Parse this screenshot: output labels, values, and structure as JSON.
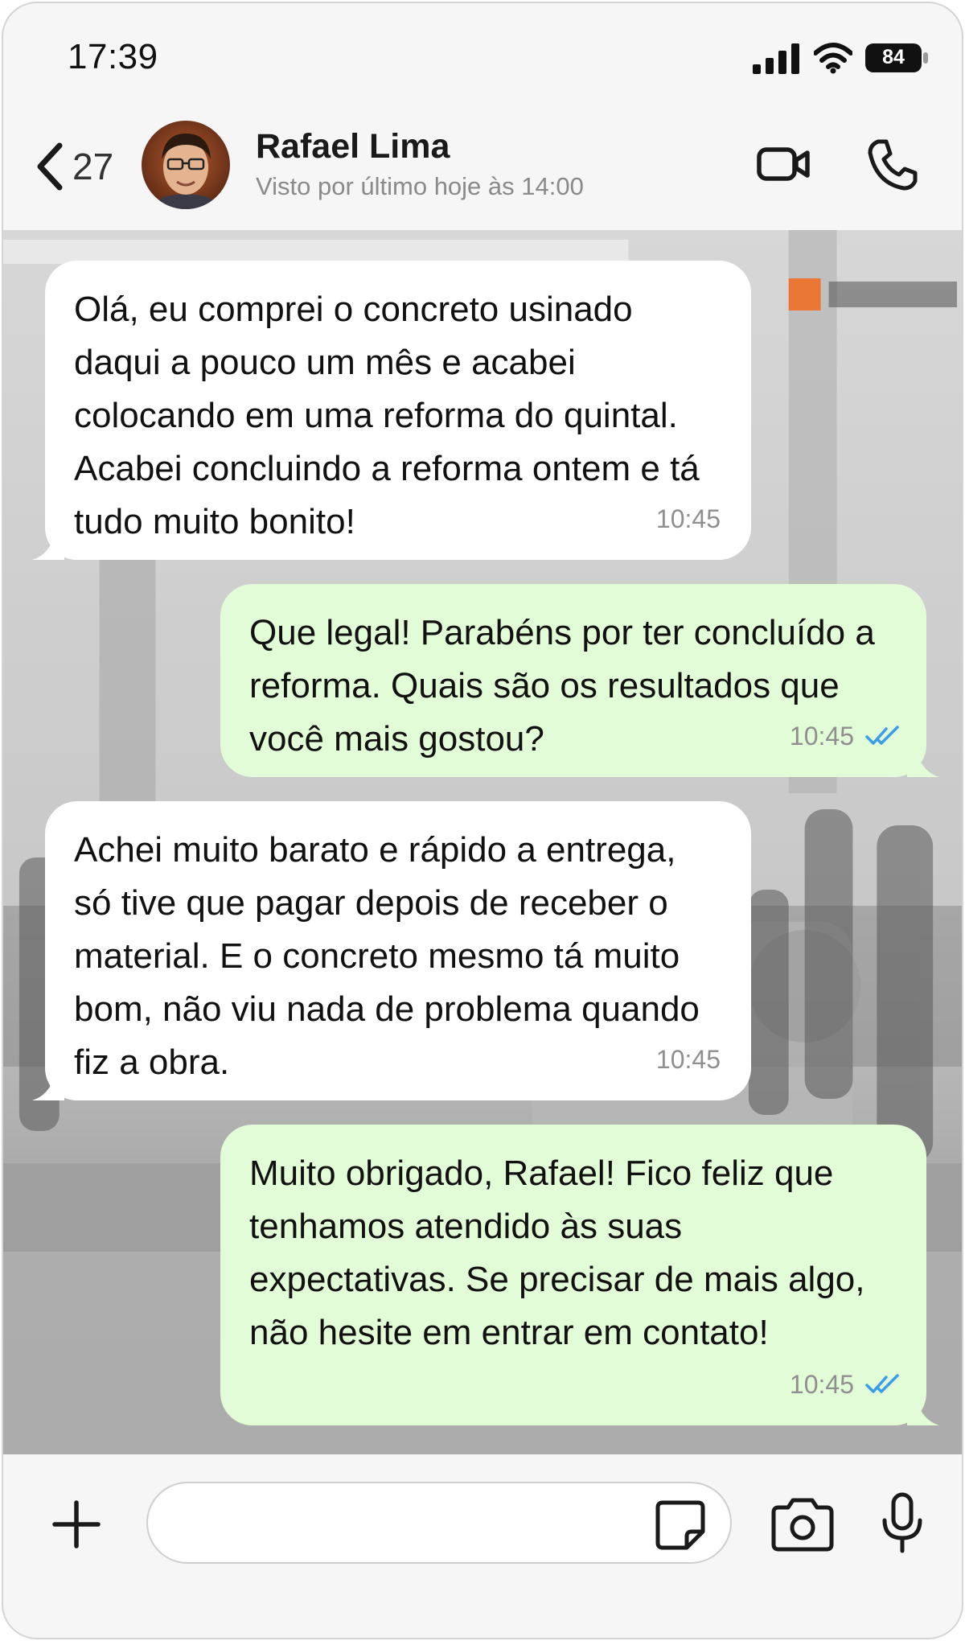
{
  "status_bar": {
    "time": "17:39",
    "battery_level": "84"
  },
  "header": {
    "back_count": "27",
    "contact_name": "Rafael Lima",
    "last_seen": "Visto por último hoje às 14:00",
    "icons": [
      "chevron-left-icon",
      "video-camera-icon",
      "phone-icon"
    ]
  },
  "messages": [
    {
      "direction": "incoming",
      "text": "Olá, eu comprei o concreto usinado daqui a pouco um mês e acabei colocando em uma reforma do quintal. Acabei concluindo a reforma ontem e tá tudo muito bonito!",
      "time": "10:45"
    },
    {
      "direction": "outgoing",
      "text": "Que legal! Parabéns por ter concluído a reforma. Quais são os resultados que você mais gostou?",
      "time": "10:45",
      "status": "read"
    },
    {
      "direction": "incoming",
      "text": "Achei muito barato e rápido a entrega, só tive que pagar depois de receber o material. E o concreto mesmo tá muito bom, não viu nada de problema quando fiz a obra.",
      "time": "10:45"
    },
    {
      "direction": "outgoing",
      "text": "Muito obrigado, Rafael! Fico feliz que tenhamos atendido às suas expectativas. Se precisar de mais algo, não hesite em entrar em contato!",
      "time": "10:45",
      "status": "read"
    }
  ],
  "input_bar": {
    "value": "",
    "icons": [
      "plus-icon",
      "sticker-icon",
      "camera-icon",
      "microphone-icon"
    ]
  },
  "colors": {
    "incoming_bubble": "#ffffff",
    "outgoing_bubble": "#e1fcd6",
    "read_ticks": "#3a9de8",
    "logo_orange": "#f26a1b"
  }
}
